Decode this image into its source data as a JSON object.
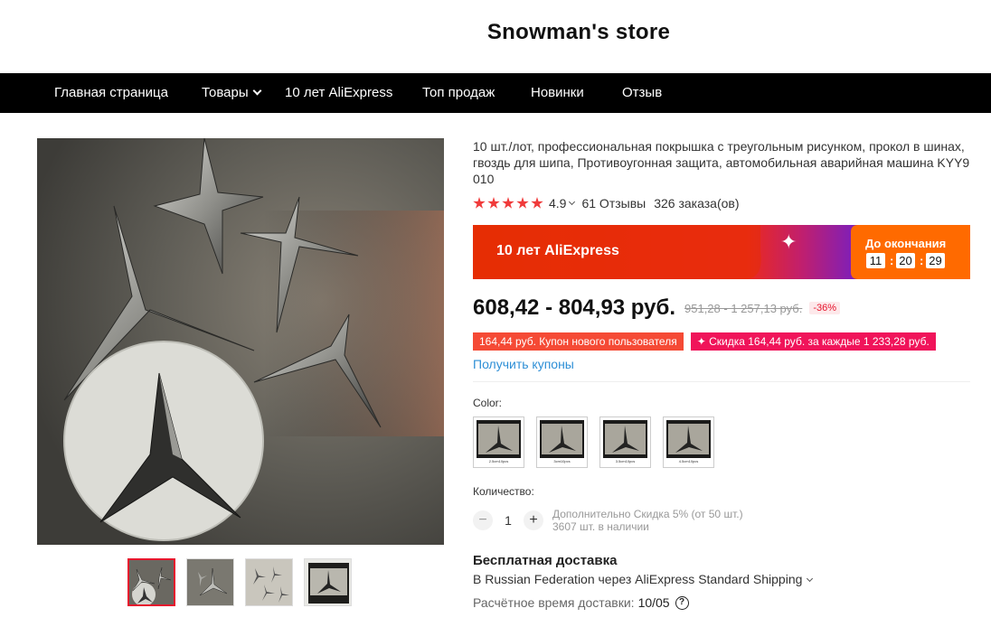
{
  "store": {
    "name": "Snowman's store"
  },
  "nav": {
    "items": [
      {
        "label": "Главная страница"
      },
      {
        "label": "Товары"
      },
      {
        "label": "10 лет AliExpress"
      },
      {
        "label": "Топ продаж"
      },
      {
        "label": "Новинки"
      },
      {
        "label": "Отзыв"
      }
    ]
  },
  "product": {
    "title": "10 шт./лот, профессиональная покрышка с треугольным рисунком, прокол в шинах, гвоздь для шипа, Противоугонная защита, автомобильная аварийная машина KYY9010",
    "rating": "4.9",
    "stars": 5,
    "reviews": "61 Отзывы",
    "orders": "326 заказа(ов)",
    "thumbnails_count": 4,
    "active_thumbnail": 1
  },
  "promo": {
    "label": "10 лет AliExpress",
    "countdown_label": "До окончания",
    "hours": "11",
    "minutes": "20",
    "seconds": "29"
  },
  "price": {
    "current": "608,42 - 804,93 руб.",
    "old": "951,28 - 1 257,13 руб.",
    "discount": "-36%"
  },
  "coupons": {
    "new_user": "164,44 руб. Купон нового пользователя",
    "per_spend": "✦ Скидка 164,44 руб. за каждые 1 233,28 руб.",
    "get_link": "Получить купоны"
  },
  "options": {
    "color_label": "Color:",
    "colors": [
      "2.5cm10pcs",
      "3cm10pcs",
      "3.5cm10pcs",
      "4.5cm10pcs"
    ]
  },
  "quantity": {
    "label": "Количество:",
    "value": "1",
    "minus": "−",
    "plus": "+",
    "discount_note": "Дополнительно Скидка 5% (от 50 шт.)",
    "stock": "3607 шт. в наличии"
  },
  "shipping": {
    "title": "Бесплатная доставка",
    "destination": "В Russian Federation через AliExpress Standard Shipping",
    "eta_label": "Расчётное время доставки:",
    "eta_value": "10/05",
    "help": "?"
  },
  "colors": {
    "accent": "#e6162d",
    "promo_start": "#e62e04",
    "promo_end": "#6a1fd0",
    "countdown_bg": "#ff6a00",
    "link": "#2e8fd6",
    "star": "#f03b3b"
  },
  "icons": {
    "nav_dropdown": "chevron-down-icon",
    "rating_dropdown": "chevron-down-icon",
    "sparkle": "sparkle-icon",
    "help": "question-circle-icon"
  }
}
